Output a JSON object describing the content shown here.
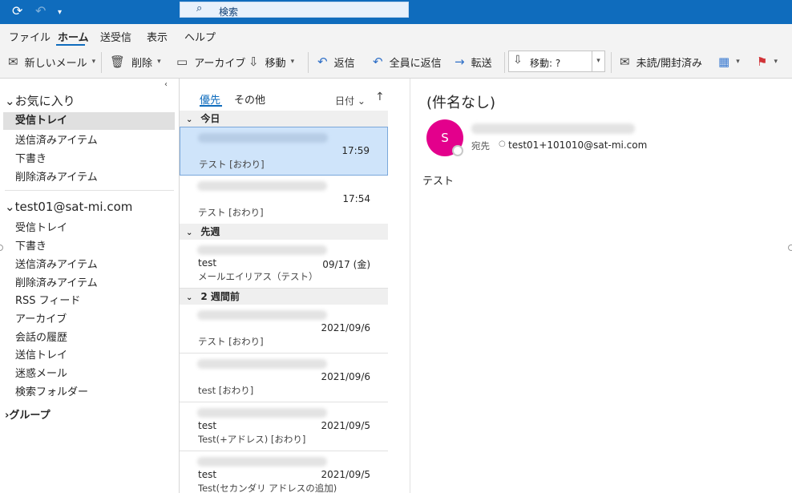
{
  "titlebar": {
    "sync_icon": "sync-icon",
    "undo_icon": "undo-icon",
    "search_placeholder": "検索"
  },
  "ribbon": {
    "tabs": [
      "ファイル",
      "ホーム",
      "送受信",
      "表示",
      "ヘルプ"
    ],
    "active_tab": "ホーム",
    "new_mail": "新しいメール",
    "delete": "削除",
    "archive": "アーカイブ",
    "move": "移動",
    "reply": "返信",
    "reply_all": "全員に返信",
    "forward": "転送",
    "move_to": "移動: ?",
    "unread_read": "未読/開封済み"
  },
  "folders": {
    "favorites_header": "お気に入り",
    "favorites": [
      "受信トレイ",
      "送信済みアイテム",
      "下書き",
      "削除済みアイテム"
    ],
    "account_header": "test01@sat-mi.com",
    "account_folders": [
      "受信トレイ",
      "下書き",
      "送信済みアイテム",
      "削除済みアイテム",
      "RSS フィード",
      "アーカイブ",
      "会話の履歴",
      "送信トレイ",
      "迷惑メール",
      "検索フォルダー"
    ],
    "groups_header": "グループ"
  },
  "message_list": {
    "focused_tab": "優先",
    "other_tab": "その他",
    "sort_label": "日付",
    "sections": {
      "today": "今日",
      "last_week": "先週",
      "two_weeks": "2 週間前"
    },
    "messages": [
      {
        "subject": "",
        "time": "17:59",
        "preview": "テスト [おわり]"
      },
      {
        "subject": "",
        "time": "17:54",
        "preview": "テスト [おわり]"
      },
      {
        "subject": "test",
        "time": "09/17 (金)",
        "preview": "メールエイリアス（テスト） [おわ"
      },
      {
        "subject": "",
        "time": "2021/09/6",
        "preview": "テスト [おわり]"
      },
      {
        "subject": "",
        "time": "2021/09/6",
        "preview": "test [おわり]"
      },
      {
        "subject": "test",
        "time": "2021/09/5",
        "preview": "Test(+アドレス) [おわり]"
      },
      {
        "subject": "test",
        "time": "2021/09/5",
        "preview": "Test(セカンダリ アドレスの追加)"
      }
    ]
  },
  "reading": {
    "subject": "(件名なし)",
    "avatar_initial": "S",
    "to_label": "宛先",
    "to_address": "test01+101010@sat-mi.com",
    "body": "テスト"
  },
  "colors": {
    "accent": "#0f6cbd",
    "selected_message": "#cfe4fa",
    "avatar": "#e3008c",
    "flag": "#d13438"
  }
}
